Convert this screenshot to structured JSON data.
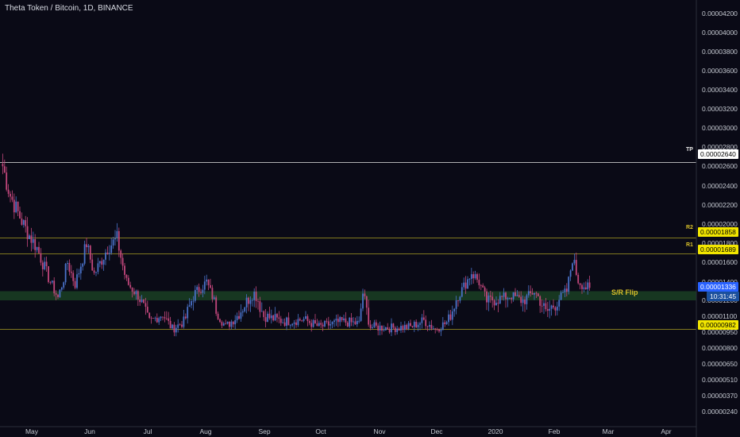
{
  "header": {
    "title": "Theta Token / Bitcoin, 1D, BINANCE"
  },
  "colors": {
    "background": "#0a0a16",
    "up_candle": "#4a72c9",
    "down_candle": "#c2477c",
    "level_line": "#b3a623",
    "tp_line": "#d9d9d9",
    "sr_zone": "#1d4a26",
    "current_price_tag": "#2962ff",
    "level_tag": "#f2e600"
  },
  "chart_data": {
    "type": "candlestick",
    "title": "Theta Token / Bitcoin, 1D, BINANCE",
    "x_tick_labels": [
      "May",
      "Jun",
      "Jul",
      "Aug",
      "Sep",
      "Oct",
      "Nov",
      "Dec",
      "2020",
      "Feb",
      "Mar",
      "Apr"
    ],
    "y_tick_labels": [
      "0.00004200",
      "0.00004000",
      "0.00003800",
      "0.00003600",
      "0.00003400",
      "0.00003200",
      "0.00003000",
      "0.00002800",
      "0.00002600",
      "0.00002400",
      "0.00002200",
      "0.00002000",
      "0.00001800",
      "0.00001600",
      "0.00001400",
      "0.00001200",
      "0.00001100",
      "0.00000950",
      "0.00000800",
      "0.00000650",
      "0.00000510",
      "0.00000370",
      "0.00000240"
    ],
    "y_scale": "log",
    "levels": [
      {
        "name": "TP",
        "value": 2.64e-05
      },
      {
        "name": "R2",
        "value": 1.858e-05
      },
      {
        "name": "R1",
        "value": 1.689e-05
      },
      {
        "name": "",
        "value": 9.82e-06
      }
    ],
    "level_tags": [
      "0.00002640",
      "0.00001858",
      "0.00001689",
      "0.00000982"
    ],
    "sr_zone": {
      "label": "S/R Flip",
      "low": 1.2e-05,
      "high": 1.3e-05
    },
    "current_price": {
      "value": 1.336e-05,
      "label": "0.00001336",
      "countdown": "10:31:45"
    },
    "anchors": [
      {
        "date": "2019-04-20",
        "close": 2.6e-05
      },
      {
        "date": "2019-04-24",
        "close": 2.3e-05
      },
      {
        "date": "2019-05-02",
        "close": 1.95e-05
      },
      {
        "date": "2019-05-08",
        "close": 1.75e-05
      },
      {
        "date": "2019-05-14",
        "close": 1.45e-05
      },
      {
        "date": "2019-05-19",
        "close": 1.23e-05
      },
      {
        "date": "2019-05-24",
        "close": 1.6e-05
      },
      {
        "date": "2019-05-28",
        "close": 1.38e-05
      },
      {
        "date": "2019-06-03",
        "close": 1.8e-05
      },
      {
        "date": "2019-06-07",
        "close": 1.48e-05
      },
      {
        "date": "2019-06-14",
        "close": 1.75e-05
      },
      {
        "date": "2019-06-19",
        "close": 1.85e-05
      },
      {
        "date": "2019-06-24",
        "close": 1.4e-05
      },
      {
        "date": "2019-06-30",
        "close": 1.25e-05
      },
      {
        "date": "2019-07-06",
        "close": 1.05e-05
      },
      {
        "date": "2019-07-13",
        "close": 1.12e-05
      },
      {
        "date": "2019-07-18",
        "close": 9.8e-06
      },
      {
        "date": "2019-07-24",
        "close": 1.05e-05
      },
      {
        "date": "2019-07-30",
        "close": 1.28e-05
      },
      {
        "date": "2019-08-05",
        "close": 1.4e-05
      },
      {
        "date": "2019-08-10",
        "close": 1.15e-05
      },
      {
        "date": "2019-08-15",
        "close": 1e-05
      },
      {
        "date": "2019-08-22",
        "close": 1.12e-05
      },
      {
        "date": "2019-08-30",
        "close": 1.28e-05
      },
      {
        "date": "2019-09-04",
        "close": 1.1e-05
      },
      {
        "date": "2019-09-15",
        "close": 1.05e-05
      },
      {
        "date": "2019-09-25",
        "close": 1.07e-05
      },
      {
        "date": "2019-10-03",
        "close": 1e-05
      },
      {
        "date": "2019-10-15",
        "close": 1.05e-05
      },
      {
        "date": "2019-10-24",
        "close": 1.03e-05
      },
      {
        "date": "2019-10-26",
        "close": 1.28e-05
      },
      {
        "date": "2019-10-30",
        "close": 1e-05
      },
      {
        "date": "2019-11-10",
        "close": 9.9e-06
      },
      {
        "date": "2019-11-20",
        "close": 1e-05
      },
      {
        "date": "2019-11-27",
        "close": 1.06e-05
      },
      {
        "date": "2019-12-03",
        "close": 9.8e-06
      },
      {
        "date": "2019-12-09",
        "close": 1.04e-05
      },
      {
        "date": "2019-12-15",
        "close": 1.25e-05
      },
      {
        "date": "2019-12-22",
        "close": 1.5e-05
      },
      {
        "date": "2019-12-26",
        "close": 1.4e-05
      },
      {
        "date": "2019-12-30",
        "close": 1.2e-05
      },
      {
        "date": "2020-01-05",
        "close": 1.22e-05
      },
      {
        "date": "2020-01-12",
        "close": 1.25e-05
      },
      {
        "date": "2020-01-18",
        "close": 1.2e-05
      },
      {
        "date": "2020-01-24",
        "close": 1.3e-05
      },
      {
        "date": "2020-01-30",
        "close": 1.12e-05
      },
      {
        "date": "2020-02-04",
        "close": 1.18e-05
      },
      {
        "date": "2020-02-10",
        "close": 1.3e-05
      },
      {
        "date": "2020-02-13",
        "close": 1.65e-05
      },
      {
        "date": "2020-02-16",
        "close": 1.42e-05
      },
      {
        "date": "2020-02-20",
        "close": 1.34e-05
      },
      {
        "date": "2020-02-22",
        "close": 1.336e-05
      }
    ]
  }
}
